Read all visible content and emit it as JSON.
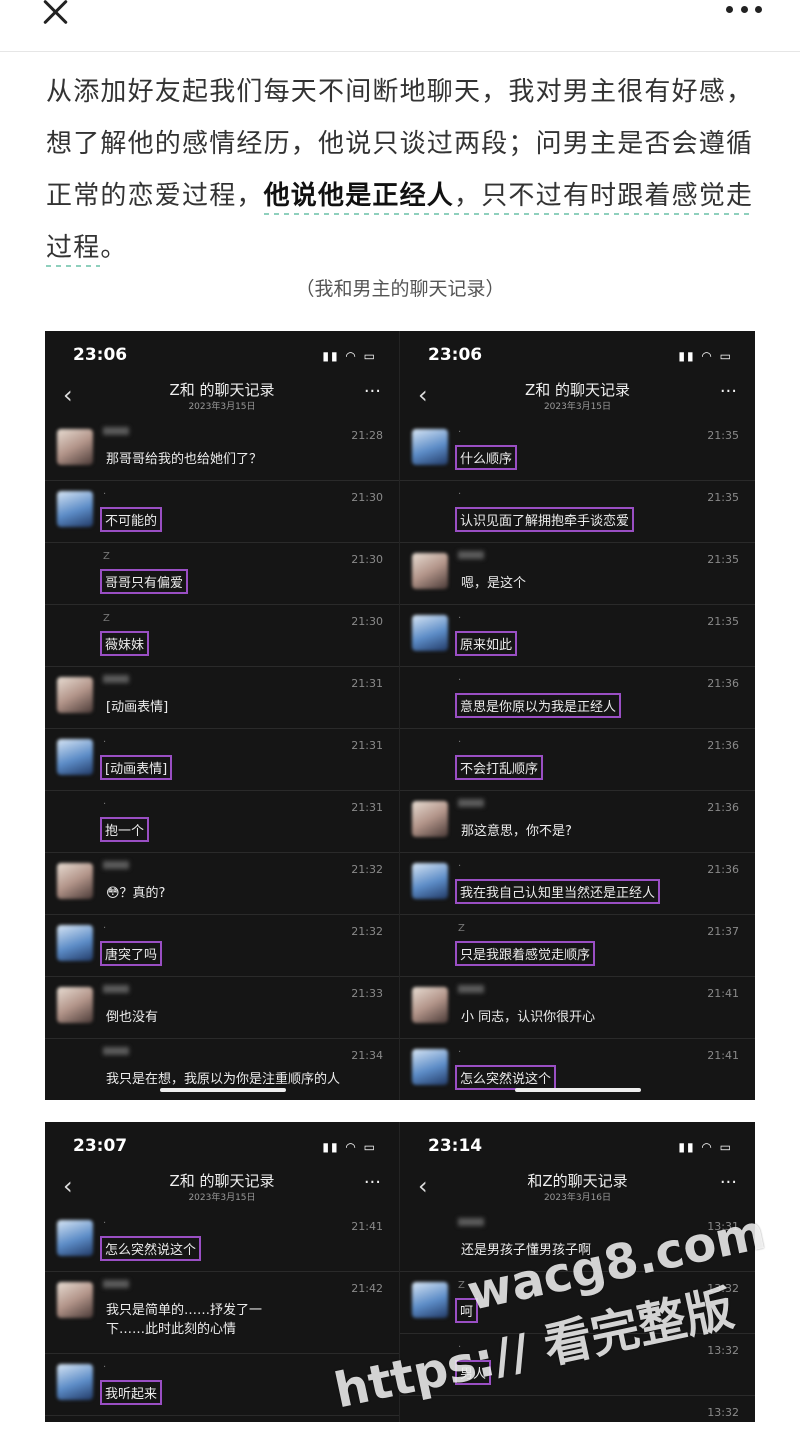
{
  "article": {
    "p1": "从添加好友起我们每天不间断地聊天，我对男主很有好感，想了解他的感情经历，他说只谈过两段；问男主是否会遵循正常的恋爱过程，",
    "bold": "他说他是正经人",
    "p2": "，只不过有时跟着感觉走",
    "p3": "过程",
    "p4": "。",
    "caption": "（我和男主的聊天记录）"
  },
  "shots": {
    "s1": {
      "time": "23:06",
      "title": "Z和      的聊天记录",
      "date": "2023年3月15日",
      "msgs": [
        {
          "time": "21:28",
          "text": "那哥哥给我的也给她们了？"
        },
        {
          "time": "21:30",
          "text": "不可能的"
        },
        {
          "time": "21:30",
          "name": "Z",
          "text": "哥哥只有偏爱"
        },
        {
          "time": "21:30",
          "name": "Z",
          "text": "薇妹妹"
        },
        {
          "time": "21:31",
          "text": "[动画表情]"
        },
        {
          "time": "21:31",
          "text": "[动画表情]"
        },
        {
          "time": "21:31",
          "text": "抱一个"
        },
        {
          "time": "21:32",
          "text": "😳？真的?"
        },
        {
          "time": "21:32",
          "text": "唐突了吗"
        },
        {
          "time": "21:33",
          "text": "倒也没有"
        },
        {
          "time": "21:34",
          "text": "我只是在想，我原以为你是注重顺序的人"
        }
      ]
    },
    "s2": {
      "time": "23:06",
      "title": "Z和      的聊天记录",
      "date": "2023年3月15日",
      "msgs": [
        {
          "time": "21:35",
          "text": "什么顺序"
        },
        {
          "time": "21:35",
          "text": "认识见面了解拥抱牵手谈恋爱"
        },
        {
          "time": "21:35",
          "text": "嗯，是这个"
        },
        {
          "time": "21:35",
          "text": "原来如此"
        },
        {
          "time": "21:36",
          "text": "意思是你原以为我是正经人"
        },
        {
          "time": "21:36",
          "text": "不会打乱顺序"
        },
        {
          "time": "21:36",
          "text": "那这意思，你不是?"
        },
        {
          "time": "21:36",
          "text": "我在我自己认知里当然还是正经人"
        },
        {
          "time": "21:37",
          "name": "Z",
          "text": "只是我跟着感觉走顺序"
        },
        {
          "time": "21:41",
          "text": "小  同志，认识你很开心"
        },
        {
          "time": "21:41",
          "text": "怎么突然说这个"
        }
      ]
    },
    "s3": {
      "time": "23:07",
      "title": "Z和      的聊天记录",
      "date": "2023年3月15日",
      "msgs": [
        {
          "time": "21:41",
          "text": "怎么突然说这个"
        },
        {
          "time": "21:42",
          "text": "我只是简单的……抒发了一下……此时此刻的心情"
        },
        {
          "time": "",
          "text": "我听起来"
        }
      ]
    },
    "s4": {
      "time": "23:14",
      "title": "      和Z的聊天记录",
      "date": "2023年3月16日",
      "msgs": [
        {
          "time": "13:31",
          "text": "还是男孩子懂男孩子啊"
        },
        {
          "time": "13:32",
          "name": "Z",
          "text": "呵"
        },
        {
          "time": "13:32",
          "text": "男人"
        },
        {
          "time": "13:32",
          "text": ""
        }
      ]
    }
  },
  "watermark": {
    "line1": "wacg8.com",
    "line2": "https://    看完整版"
  }
}
